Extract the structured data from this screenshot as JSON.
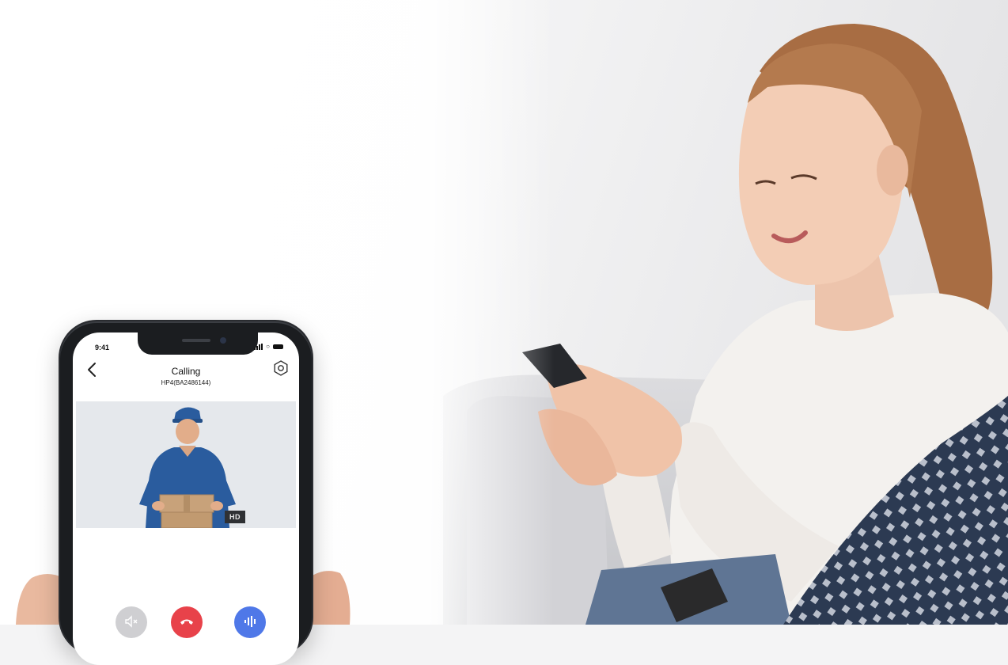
{
  "status_bar": {
    "time": "9:41"
  },
  "call": {
    "title": "Calling",
    "device_id": "HP4(BA2486144)"
  },
  "video": {
    "quality_badge": "HD"
  },
  "icons": [
    "back-icon",
    "settings-icon",
    "mute-icon",
    "hangup-icon",
    "talk-icon",
    "signal-icon",
    "wifi-icon",
    "battery-icon"
  ],
  "colors": {
    "hangup": "#e8424a",
    "talk": "#4f78e8",
    "mute": "#cfcfd2",
    "courier_uniform": "#2a5c9e"
  }
}
